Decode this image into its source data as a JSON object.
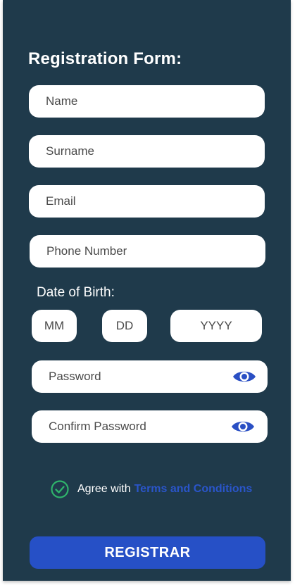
{
  "form": {
    "title": "Registration Form:",
    "fields": {
      "name": {
        "placeholder": "Name"
      },
      "surname": {
        "placeholder": "Surname"
      },
      "email": {
        "placeholder": "Email"
      },
      "phone": {
        "placeholder": "Phone Number"
      }
    },
    "dob": {
      "label": "Date of Birth:",
      "month": "MM",
      "day": "DD",
      "year": "YYYY"
    },
    "password": {
      "placeholder": "Password",
      "icon": "eye-icon"
    },
    "confirm_password": {
      "placeholder": "Confirm Password",
      "icon": "eye-icon"
    },
    "agree": {
      "text": "Agree with",
      "link": "Terms and Conditions",
      "checked": true,
      "icon": "check-circle-icon"
    },
    "submit_label": "REGISTRAR"
  },
  "colors": {
    "background": "#1f3a4b",
    "accent": "#2650c6",
    "eye_icon": "#2a4fc4",
    "check": "#2fb36b",
    "field": "#ffffff"
  }
}
